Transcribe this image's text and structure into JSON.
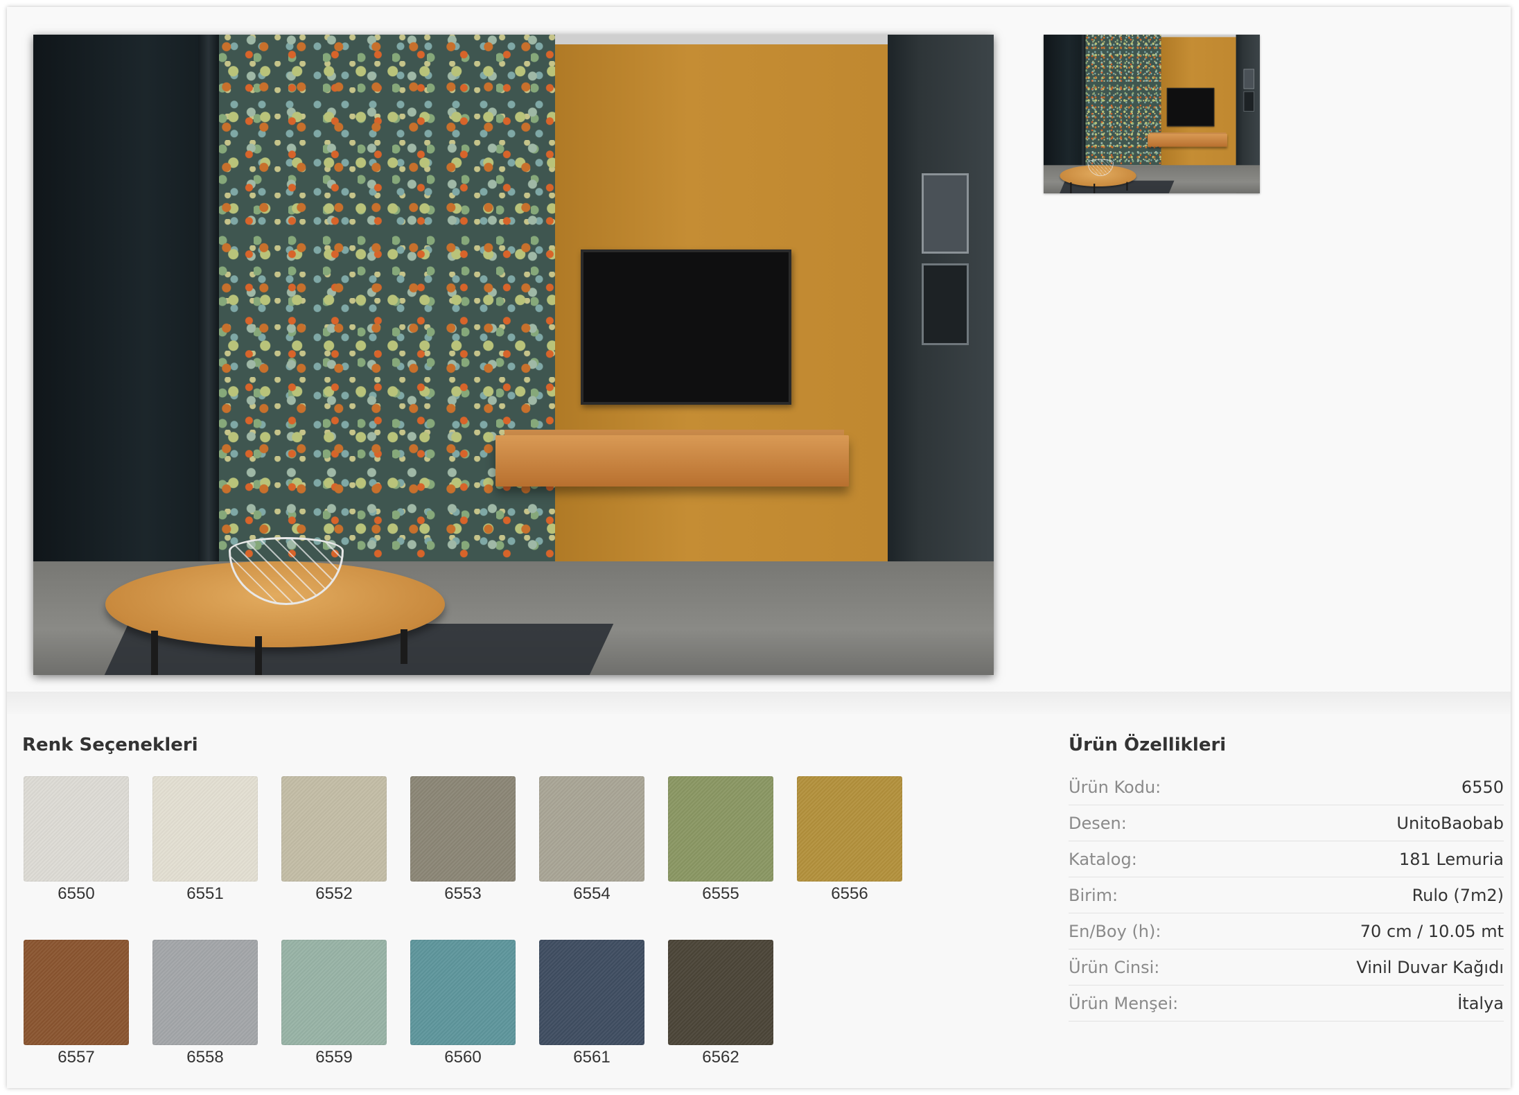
{
  "colors_section": {
    "title": "Renk Seçenekleri",
    "swatches": [
      {
        "code": "6550",
        "color": "#dddbd5"
      },
      {
        "code": "6551",
        "color": "#e3dfd2"
      },
      {
        "code": "6552",
        "color": "#c3bda6"
      },
      {
        "code": "6553",
        "color": "#8b8676"
      },
      {
        "code": "6554",
        "color": "#a9a596"
      },
      {
        "code": "6555",
        "color": "#8a9763"
      },
      {
        "code": "6556",
        "color": "#b3913c"
      },
      {
        "code": "6557",
        "color": "#8a5530"
      },
      {
        "code": "6558",
        "color": "#a3a6a9"
      },
      {
        "code": "6559",
        "color": "#98b3a6"
      },
      {
        "code": "6560",
        "color": "#5e969c"
      },
      {
        "code": "6561",
        "color": "#3f4d61"
      },
      {
        "code": "6562",
        "color": "#4b4538"
      }
    ]
  },
  "properties_section": {
    "title": "Ürün Özellikleri",
    "rows": [
      {
        "label": "Ürün Kodu:",
        "value": "6550"
      },
      {
        "label": "Desen:",
        "value": "UnitoBaobab"
      },
      {
        "label": "Katalog:",
        "value": "181 Lemuria"
      },
      {
        "label": "Birim:",
        "value": "Rulo (7m2)"
      },
      {
        "label": "En/Boy (h):",
        "value": "70 cm / 10.05 mt"
      },
      {
        "label": "Ürün Cinsi:",
        "value": "Vinil Duvar Kağıdı"
      },
      {
        "label": "Ürün Menşei:",
        "value": "İtalya"
      }
    ]
  }
}
